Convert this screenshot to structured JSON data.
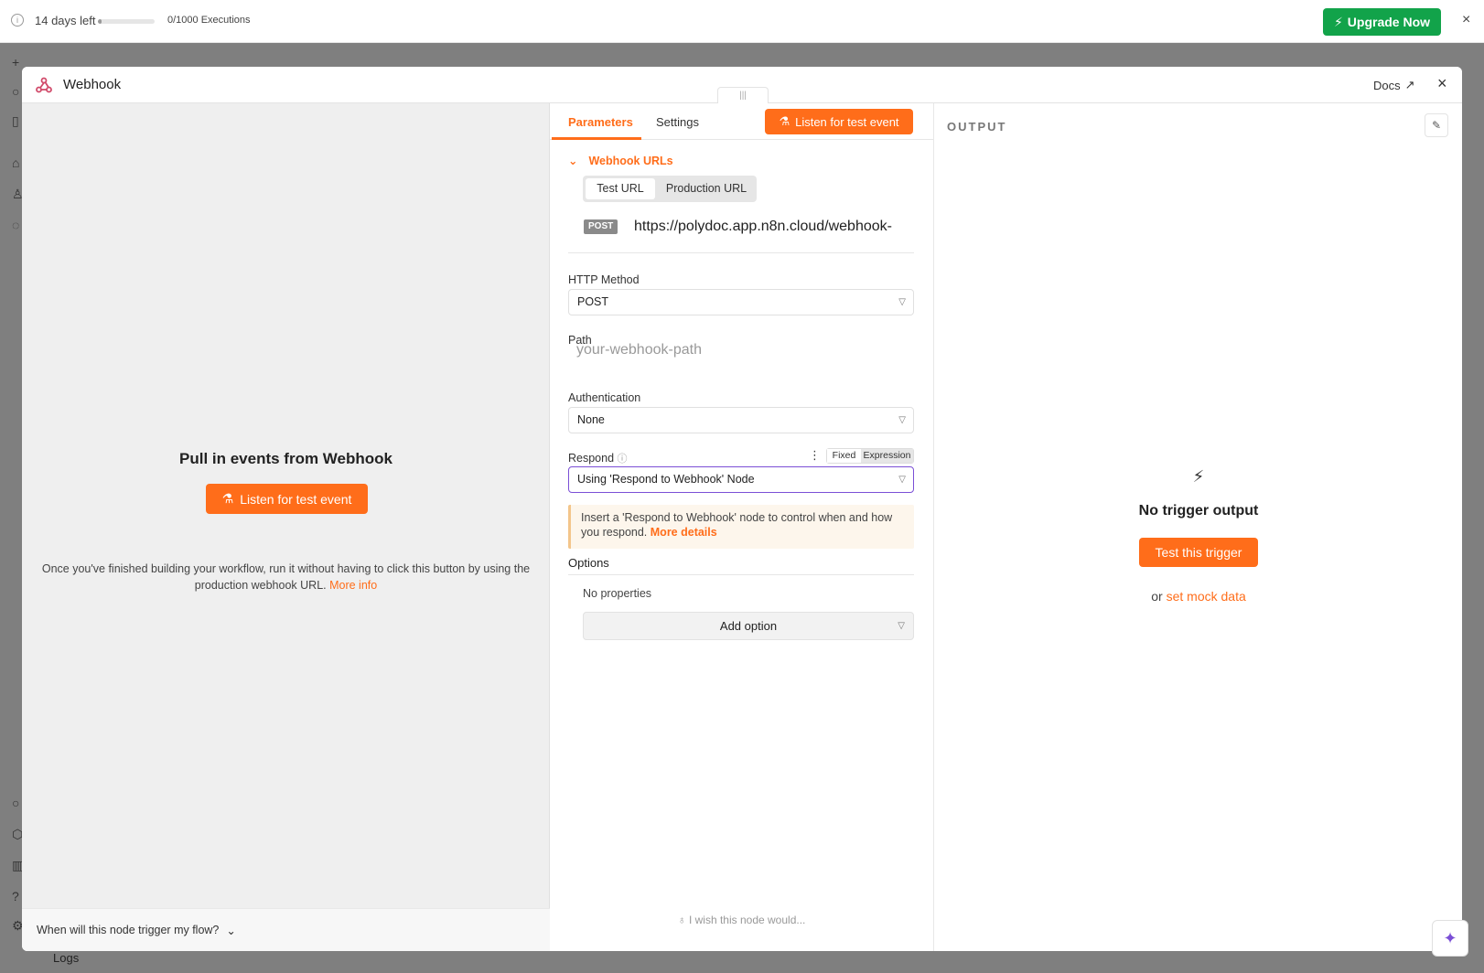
{
  "trial_bar": {
    "days_left": "14 days left",
    "executions": "0/1000 Executions",
    "execution_progress": 0.0,
    "upgrade_label": "Upgrade Now",
    "close_label": "×"
  },
  "app": {
    "logs_label": "Logs"
  },
  "modal": {
    "title": "Webhook",
    "docs_label": "Docs",
    "close_label": "×",
    "drag_handle": "|||"
  },
  "input_panel": {
    "heading": "Pull in events from Webhook",
    "listen_button": "Listen for test event",
    "hint_text": "Once you've finished building your workflow, run it without having to click this button by using the production webhook URL.",
    "hint_link": "More info",
    "footer_question": "When will this node trigger my flow?"
  },
  "parameters": {
    "tabs": [
      {
        "label": "Parameters",
        "active": true
      },
      {
        "label": "Settings",
        "active": false
      }
    ],
    "listen_button": "Listen for test event",
    "webhook_urls": {
      "section_label": "Webhook URLs",
      "tab_test": "Test URL",
      "tab_production": "Production URL",
      "method": "POST",
      "url": "https://polydoc.app.n8n.cloud/webhook-"
    },
    "http_method": {
      "label": "HTTP Method",
      "value": "POST"
    },
    "path": {
      "label": "Path",
      "placeholder": "your-webhook-path"
    },
    "authentication": {
      "label": "Authentication",
      "value": "None"
    },
    "respond": {
      "label": "Respond",
      "mode_fixed": "Fixed",
      "mode_expression": "Expression",
      "value": "Using 'Respond to Webhook' Node"
    },
    "notice": {
      "text": "Insert a 'Respond to Webhook' node to control when and how you respond.",
      "link": "More details"
    },
    "options": {
      "label": "Options",
      "empty": "No properties",
      "add_button": "Add option"
    },
    "wish": "I wish this node would..."
  },
  "output": {
    "title": "OUTPUT",
    "empty_title": "No trigger output",
    "test_button": "Test this trigger",
    "mock_prefix": "or",
    "mock_link": "set mock data"
  },
  "colors": {
    "accent": "#ff6d1a",
    "upgrade": "#12a34a",
    "respond_focus": "#7b4fd6"
  }
}
